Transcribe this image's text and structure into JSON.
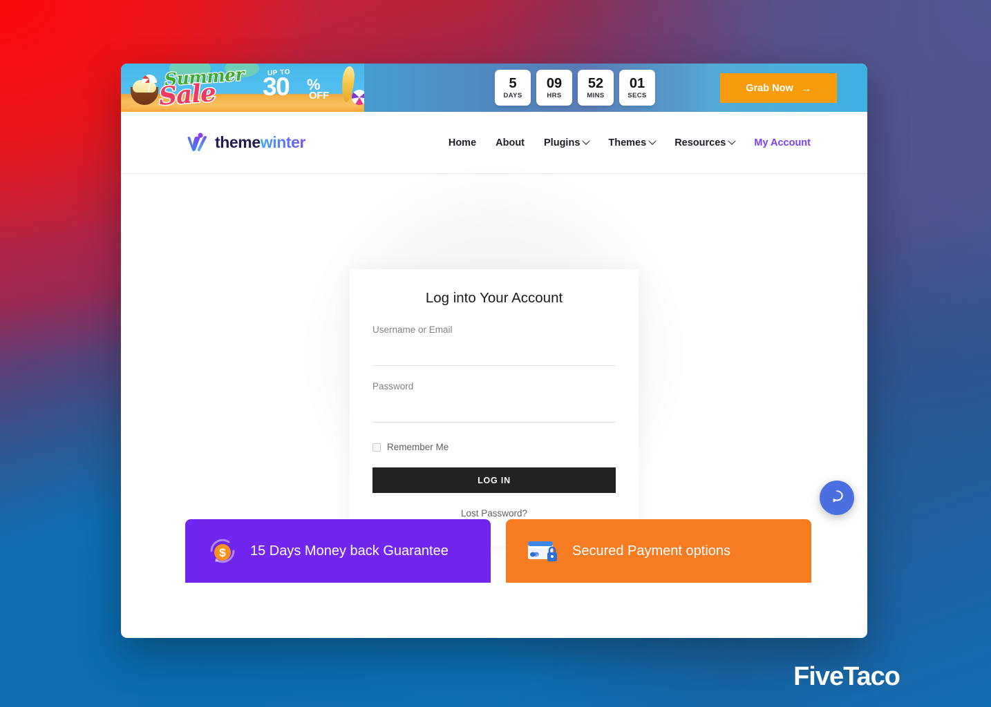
{
  "promo": {
    "summer_word": "Summer",
    "sale_word": "Sale",
    "upto_label": "UP TO",
    "discount_number": "30",
    "percent_sign": "%",
    "off_label": "OFF",
    "countdown": [
      {
        "value": "5",
        "unit": "DAYS"
      },
      {
        "value": "09",
        "unit": "HRS"
      },
      {
        "value": "52",
        "unit": "MINS"
      },
      {
        "value": "01",
        "unit": "SECS"
      }
    ],
    "cta_label": "Grab Now",
    "cta_arrow": "→",
    "cta_color": "#f89c0e"
  },
  "nav": {
    "logo": {
      "part1": "theme",
      "part2": "winter"
    },
    "items": [
      {
        "label": "Home",
        "dropdown": false,
        "active": false
      },
      {
        "label": "About",
        "dropdown": false,
        "active": false
      },
      {
        "label": "Plugins",
        "dropdown": true,
        "active": false
      },
      {
        "label": "Themes",
        "dropdown": true,
        "active": false
      },
      {
        "label": "Resources",
        "dropdown": true,
        "active": false
      },
      {
        "label": "My Account",
        "dropdown": false,
        "active": true
      }
    ],
    "active_color": "#7b3ff2"
  },
  "login": {
    "title": "Log into Your Account",
    "username_label": "Username or Email",
    "username_value": "",
    "username_placeholder": "",
    "password_label": "Password",
    "password_value": "",
    "password_placeholder": "",
    "remember_label": "Remember Me",
    "submit_label": "LOG IN",
    "lost_password_label": "Lost Password?"
  },
  "cards": [
    {
      "text": "15 Days Money back Guarantee",
      "color": "#7126f0",
      "icon": "refund-icon"
    },
    {
      "text": "Secured Payment options",
      "color": "#f57c22",
      "icon": "secure-card-icon"
    }
  ],
  "chat": {
    "icon": "chat-bubble-icon",
    "color": "#4b6fe0"
  },
  "watermark": {
    "text": "FiveTaco"
  }
}
